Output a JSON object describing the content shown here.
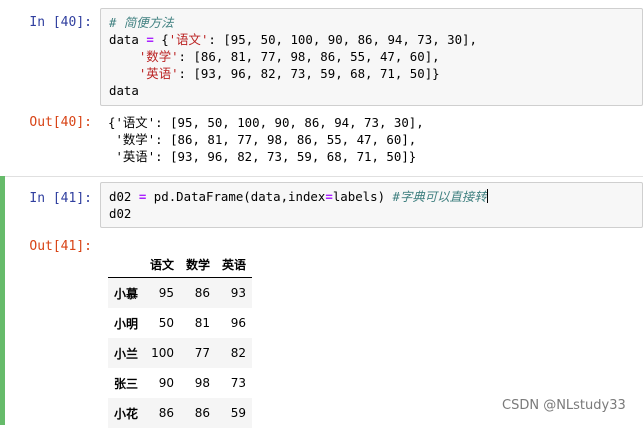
{
  "cells": [
    {
      "in_prompt": "In [40]:",
      "out_prompt": "Out[40]:",
      "comment": "# 简便方法",
      "code": {
        "l1a": "data ",
        "l1op": "=",
        "l1b": " {",
        "l1key": "'语文'",
        "l1rest": ": [95, 50, 100, 90, 86, 94, 73, 30],",
        "l2indent": "    ",
        "l2key": "'数学'",
        "l2rest": ": [86, 81, 77, 98, 86, 55, 47, 60],",
        "l3indent": "    ",
        "l3key": "'英语'",
        "l3rest": ": [93, 96, 82, 73, 59, 68, 71, 50]}",
        "l4": "data"
      },
      "output_lines": [
        "{'语文': [95, 50, 100, 90, 86, 94, 73, 30],",
        " '数学': [86, 81, 77, 98, 86, 55, 47, 60],",
        " '英语': [93, 96, 82, 73, 59, 68, 71, 50]}"
      ]
    },
    {
      "in_prompt": "In [41]:",
      "out_prompt": "Out[41]:",
      "code": {
        "l1a": "d02 ",
        "l1op": "=",
        "l1b": " pd.DataFrame(data,index",
        "l1op2": "=",
        "l1c": "labels) ",
        "l1comment": "#字典可以直接转",
        "l2": "d02"
      }
    }
  ],
  "dataframe": {
    "columns": [
      "语文",
      "数学",
      "英语"
    ],
    "rows": [
      {
        "index": "小慕",
        "values": [
          "95",
          "86",
          "93"
        ]
      },
      {
        "index": "小明",
        "values": [
          "50",
          "81",
          "96"
        ]
      },
      {
        "index": "小兰",
        "values": [
          "100",
          "77",
          "82"
        ]
      },
      {
        "index": "张三",
        "values": [
          "90",
          "98",
          "73"
        ]
      },
      {
        "index": "小花",
        "values": [
          "86",
          "86",
          "59"
        ]
      }
    ]
  },
  "watermark": "CSDN @NLstudy33",
  "colors": {
    "in_prompt": "#303f9f",
    "out_prompt": "#d84315",
    "selected_bar": "#66bb6a",
    "input_bg": "#f7f7f7"
  }
}
